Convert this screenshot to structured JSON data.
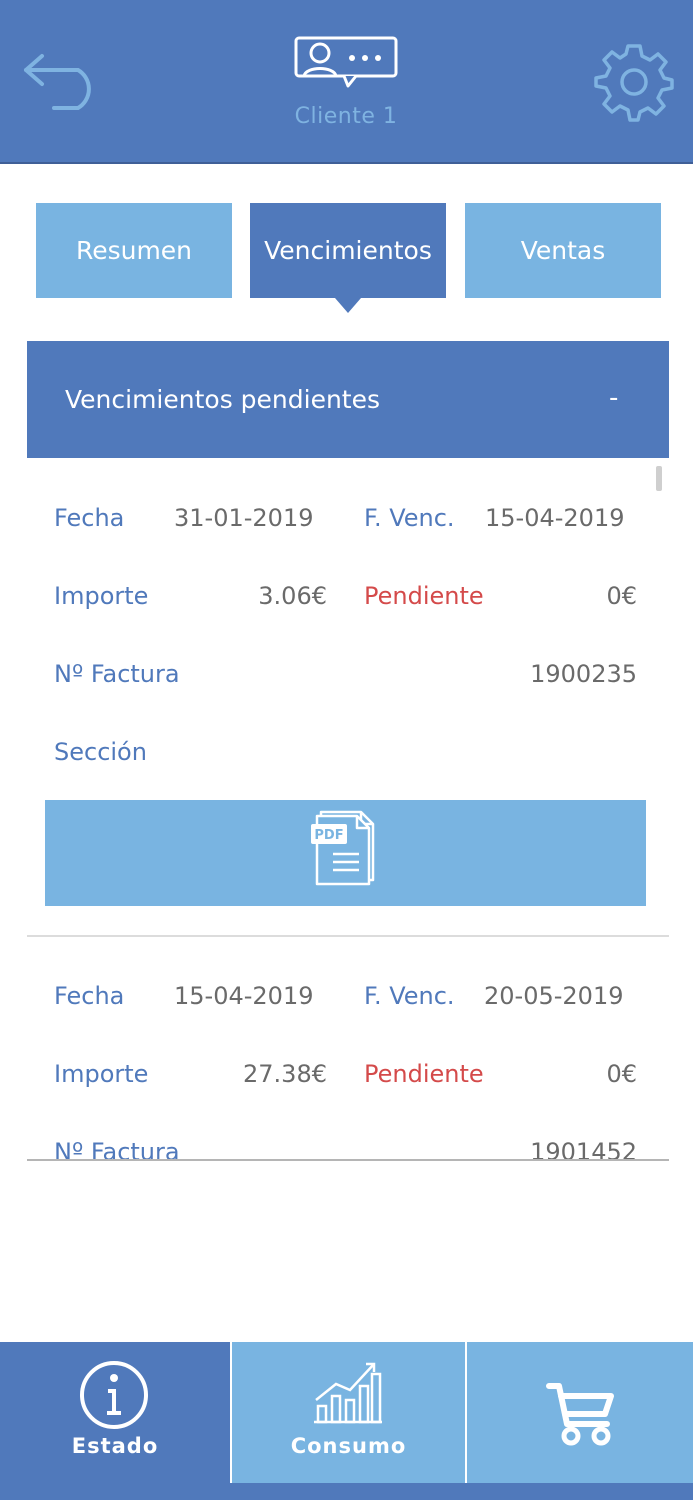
{
  "header": {
    "client_name": "Cliente 1",
    "back_icon": "back-arrow-icon",
    "settings_icon": "gear-icon",
    "client_icon": "client-chat-icon"
  },
  "tabs": [
    {
      "label": "Resumen",
      "active": false
    },
    {
      "label": "Vencimientos",
      "active": true
    },
    {
      "label": "Ventas",
      "active": false
    }
  ],
  "section": {
    "title": "Vencimientos pendientes",
    "toggle": "-"
  },
  "invoices": [
    {
      "fecha_label": "Fecha",
      "fecha": "31-01-2019",
      "venc_label": "F. Venc.",
      "venc": "15-04-2019",
      "importe_label": "Importe",
      "importe": "3.06€",
      "pendiente_label": "Pendiente",
      "pendiente": "0€",
      "factura_label": "Nº Factura",
      "factura": "1900235",
      "seccion_label": "Sección",
      "pdf_icon": "pdf-document-icon"
    },
    {
      "fecha_label": "Fecha",
      "fecha": "15-04-2019",
      "venc_label": "F. Venc.",
      "venc": "20-05-2019",
      "importe_label": "Importe",
      "importe": "27.38€",
      "pendiente_label": "Pendiente",
      "pendiente": "0€",
      "factura_label": "Nº Factura",
      "factura": "1901452"
    }
  ],
  "bottom_nav": [
    {
      "label": "Estado",
      "icon": "info-icon",
      "active": true
    },
    {
      "label": "Consumo",
      "icon": "bar-chart-icon",
      "active": false
    },
    {
      "label": "",
      "icon": "cart-icon",
      "active": false
    }
  ],
  "colors": {
    "primary": "#5079bb",
    "light": "#79b4e1",
    "label": "#5079bb",
    "value": "#6a6a6a",
    "pending": "#d44a4a"
  }
}
